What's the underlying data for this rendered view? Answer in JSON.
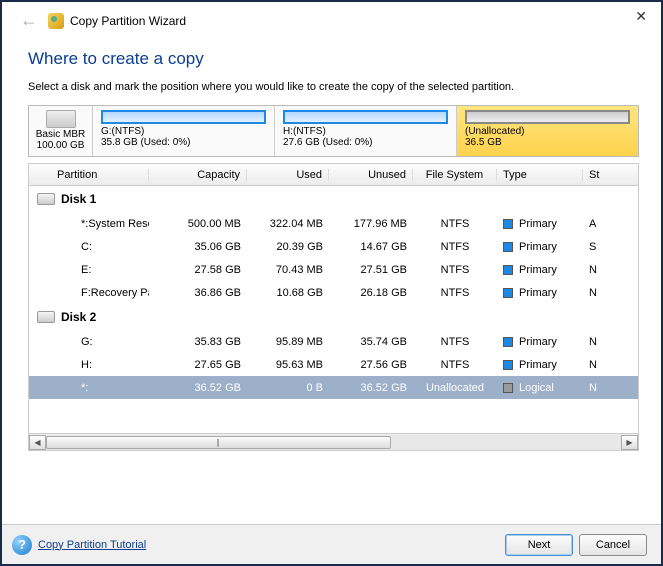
{
  "window": {
    "title": "Copy Partition Wizard",
    "heading": "Where to create a copy",
    "subtext": "Select a disk and mark the position where you would like to create the copy of the selected partition."
  },
  "diskbar": {
    "left": {
      "line1": "Basic MBR",
      "line2": "100.00 GB"
    },
    "segments": [
      {
        "line1": "G:(NTFS)",
        "line2": "35.8 GB (Used: 0%)",
        "style": "blue"
      },
      {
        "line1": "H:(NTFS)",
        "line2": "27.6 GB (Used: 0%)",
        "style": "blue"
      },
      {
        "line1": "(Unallocated)",
        "line2": "36.5 GB",
        "style": "unalloc"
      }
    ]
  },
  "columns": {
    "partition": "Partition",
    "capacity": "Capacity",
    "used": "Used",
    "unused": "Unused",
    "filesystem": "File System",
    "type": "Type",
    "status": "St"
  },
  "groups": [
    {
      "name": "Disk 1",
      "rows": [
        {
          "partition": "*:System Rese...",
          "capacity": "500.00 MB",
          "used": "322.04 MB",
          "unused": "177.96 MB",
          "fs": "NTFS",
          "type": "Primary",
          "sq": "blue",
          "st": "A"
        },
        {
          "partition": "C:",
          "capacity": "35.06 GB",
          "used": "20.39 GB",
          "unused": "14.67 GB",
          "fs": "NTFS",
          "type": "Primary",
          "sq": "blue",
          "st": "S"
        },
        {
          "partition": "E:",
          "capacity": "27.58 GB",
          "used": "70.43 MB",
          "unused": "27.51 GB",
          "fs": "NTFS",
          "type": "Primary",
          "sq": "blue",
          "st": "N"
        },
        {
          "partition": "F:Recovery Pa...",
          "capacity": "36.86 GB",
          "used": "10.68 GB",
          "unused": "26.18 GB",
          "fs": "NTFS",
          "type": "Primary",
          "sq": "blue",
          "st": "N"
        }
      ]
    },
    {
      "name": "Disk 2",
      "rows": [
        {
          "partition": "G:",
          "capacity": "35.83 GB",
          "used": "95.89 MB",
          "unused": "35.74 GB",
          "fs": "NTFS",
          "type": "Primary",
          "sq": "blue",
          "st": "N"
        },
        {
          "partition": "H:",
          "capacity": "27.65 GB",
          "used": "95.63 MB",
          "unused": "27.56 GB",
          "fs": "NTFS",
          "type": "Primary",
          "sq": "blue",
          "st": "N"
        },
        {
          "partition": "*:",
          "capacity": "36.52 GB",
          "used": "0 B",
          "unused": "36.52 GB",
          "fs": "Unallocated",
          "type": "Logical",
          "sq": "gray",
          "st": "N",
          "selected": true
        }
      ]
    }
  ],
  "footer": {
    "help_link": "Copy Partition Tutorial",
    "next": "Next",
    "cancel": "Cancel"
  }
}
